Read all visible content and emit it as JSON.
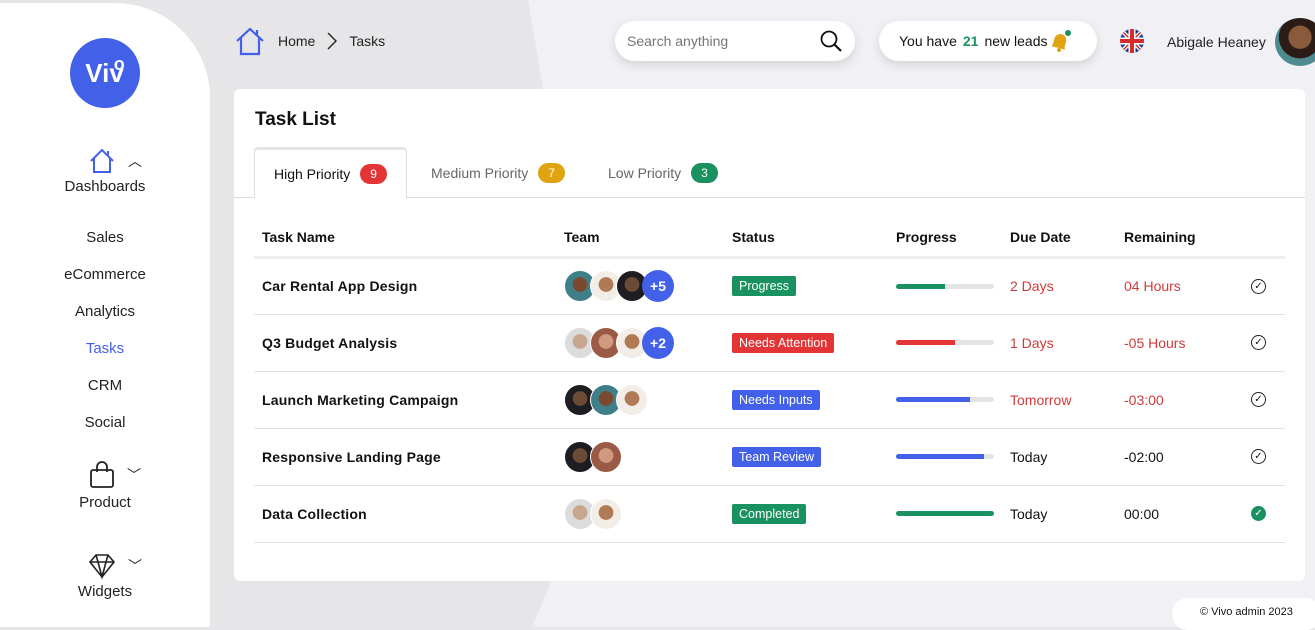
{
  "brand": {
    "logo_text": "Viv",
    "logo_sup": "o",
    "accent": "#4361e8"
  },
  "sidebar": {
    "dashboards": {
      "label": "Dashboards",
      "icon": "home-icon",
      "expanded": true
    },
    "items": [
      {
        "label": "Sales"
      },
      {
        "label": "eCommerce"
      },
      {
        "label": "Analytics"
      },
      {
        "label": "Tasks",
        "active": true
      },
      {
        "label": "CRM"
      },
      {
        "label": "Social"
      }
    ],
    "product": {
      "label": "Product",
      "icon": "shopping-bag-icon"
    },
    "widgets": {
      "label": "Widgets",
      "icon": "diamond-icon"
    }
  },
  "breadcrumb": {
    "home": "Home",
    "current": "Tasks"
  },
  "search": {
    "placeholder": "Search anything"
  },
  "leads": {
    "prefix": "You have",
    "count": "21",
    "suffix": "new leads"
  },
  "user": {
    "name": "Abigale Heaney",
    "language": "UK"
  },
  "card": {
    "title": "Task List",
    "tabs": [
      {
        "label": "High Priority",
        "count": "9",
        "color": "#e33535"
      },
      {
        "label": "Medium Priority",
        "count": "7",
        "color": "#e0a312"
      },
      {
        "label": "Low Priority",
        "count": "3",
        "color": "#1a9160"
      }
    ],
    "columns": [
      "Task Name",
      "Team",
      "Status",
      "Progress",
      "Due Date",
      "Remaining"
    ],
    "rows": [
      {
        "name": "Car Rental App Design",
        "team_more": "+5",
        "status": "Progress",
        "status_color": "#1a9160",
        "progress": 50,
        "due": "2 Days",
        "remaining": "04 Hours",
        "overdue": true,
        "completed": false
      },
      {
        "name": "Q3 Budget Analysis",
        "team_more": "+2",
        "status": "Needs Attention",
        "status_color": "#e33535",
        "progress": 60,
        "due": "1 Days",
        "remaining": "-05 Hours",
        "overdue": true,
        "completed": false
      },
      {
        "name": "Launch Marketing Campaign",
        "team_more": "",
        "status": "Needs Inputs",
        "status_color": "#4361e8",
        "progress": 75,
        "due": "Tomorrow",
        "remaining": "-03:00",
        "overdue": true,
        "completed": false
      },
      {
        "name": "Responsive Landing Page",
        "team_more": "",
        "status": "Team Review",
        "status_color": "#4361e8",
        "progress": 90,
        "due": "Today",
        "remaining": "-02:00",
        "overdue": false,
        "completed": false
      },
      {
        "name": "Data Collection",
        "team_more": "",
        "status": "Completed",
        "status_color": "#1a9160",
        "progress": 100,
        "due": "Today",
        "remaining": "00:00",
        "overdue": false,
        "completed": true
      }
    ]
  },
  "footer": {
    "text": "© Vivo admin 2023"
  }
}
